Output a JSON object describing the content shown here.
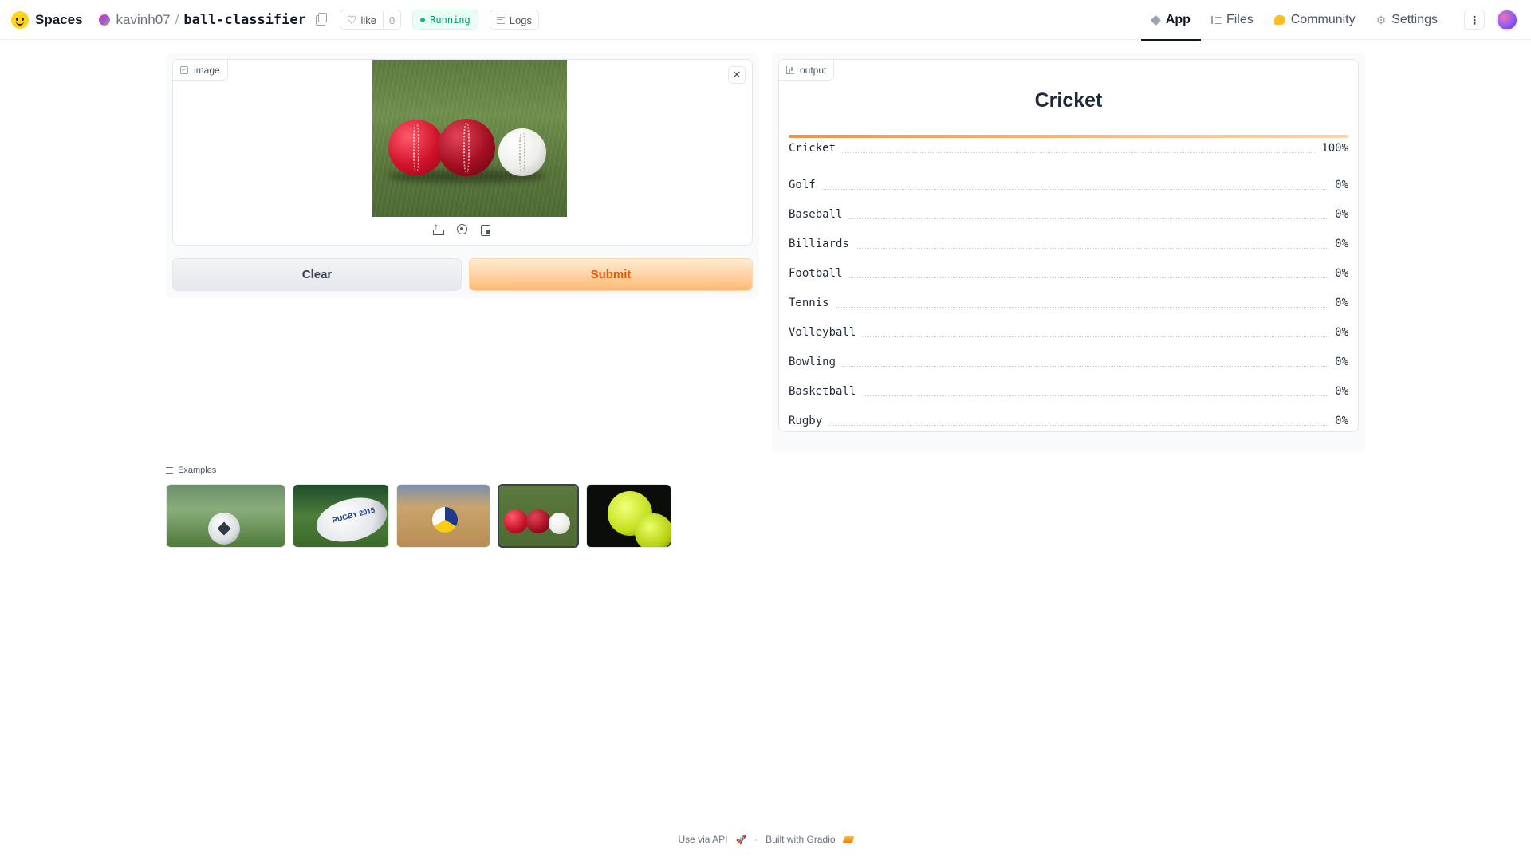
{
  "header": {
    "brand": "Spaces",
    "owner": "kavinh07",
    "separator": "/",
    "repo": "ball-classifier",
    "like_label": "like",
    "like_count": "0",
    "status": "Running",
    "logs_label": "Logs",
    "tabs": [
      {
        "label": "App",
        "icon": "app-icon",
        "active": true
      },
      {
        "label": "Files",
        "icon": "files-icon",
        "active": false
      },
      {
        "label": "Community",
        "icon": "community-icon",
        "active": false
      },
      {
        "label": "Settings",
        "icon": "gear-icon",
        "active": false
      }
    ],
    "more_label": "⋮"
  },
  "input": {
    "label": "image",
    "close_symbol": "✕",
    "clear_label": "Clear",
    "submit_label": "Submit"
  },
  "output": {
    "label": "output",
    "top_label": "Cricket",
    "confidences": [
      {
        "label": "Cricket",
        "value": "100%",
        "fraction": 1.0
      },
      {
        "label": "Golf",
        "value": "0%",
        "fraction": 0
      },
      {
        "label": "Baseball",
        "value": "0%",
        "fraction": 0
      },
      {
        "label": "Billiards",
        "value": "0%",
        "fraction": 0
      },
      {
        "label": "Football",
        "value": "0%",
        "fraction": 0
      },
      {
        "label": "Tennis",
        "value": "0%",
        "fraction": 0
      },
      {
        "label": "Volleyball",
        "value": "0%",
        "fraction": 0
      },
      {
        "label": "Bowling",
        "value": "0%",
        "fraction": 0
      },
      {
        "label": "Basketball",
        "value": "0%",
        "fraction": 0
      },
      {
        "label": "Rugby",
        "value": "0%",
        "fraction": 0
      }
    ]
  },
  "examples": {
    "label": "Examples",
    "rugby_ball_text": "RUGBY 2015"
  },
  "footer": {
    "api_label": "Use via API",
    "separator": "·",
    "built_label": "Built with Gradio"
  },
  "colors": {
    "accent": "#f97316",
    "running": "#059669",
    "bar": "#f0924a"
  }
}
